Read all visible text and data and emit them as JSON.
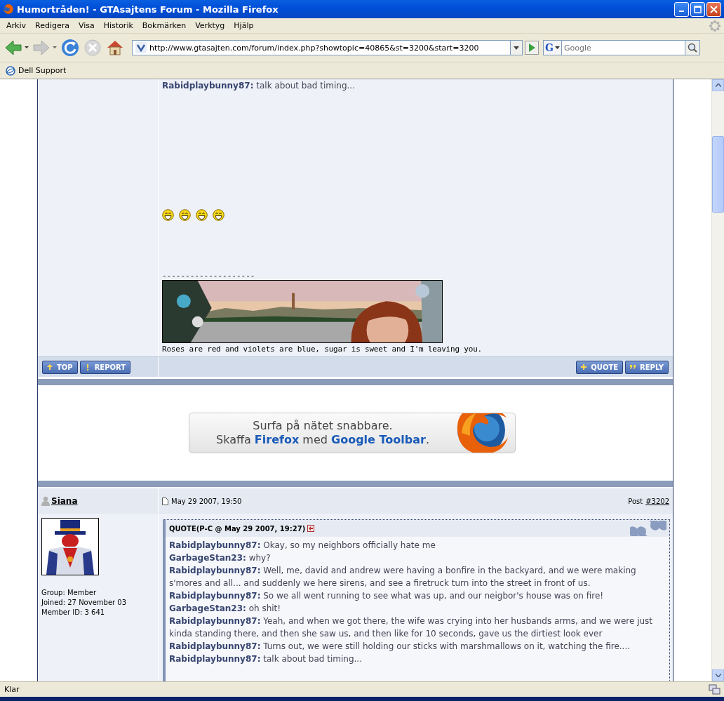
{
  "window": {
    "title": "Humortråden! - GTAsajtens Forum - Mozilla Firefox"
  },
  "menu": [
    "Arkiv",
    "Redigera",
    "Visa",
    "Historik",
    "Bokmärken",
    "Verktyg",
    "Hjälp"
  ],
  "toolbar": {
    "url": "http://www.gtasajten.com/forum/index.php?showtopic=40865&st=3200&start=3200",
    "search_engine": "G",
    "search_placeholder": "Google"
  },
  "bookmarks": [
    "Dell Support"
  ],
  "post_1": {
    "lines": [
      "**Rabidplaybunny87:** talk about bad timing..."
    ],
    "signature_rule": "--------------------",
    "signature": "Roses are red and violets are blue, sugar is sweet and I'm leaving you.",
    "buttons_left": [
      {
        "kind": "up",
        "label": "TOP"
      },
      {
        "kind": "alert",
        "label": "REPORT"
      }
    ],
    "buttons_right": [
      {
        "kind": "plus",
        "label": "QUOTE"
      },
      {
        "kind": "quote",
        "label": "REPLY"
      }
    ]
  },
  "ad": {
    "line_1": "Surfa på nätet snabbare.",
    "line_2": "Skaffa **Firefox** med **Google Toolbar**."
  },
  "post_2": {
    "author": "Siana",
    "date": "May 29 2007, 19:50",
    "post_label": "Post",
    "post_number": "#3202",
    "member_info": [
      "Group: Member",
      "Joined: 27 November 03",
      "Member ID: 3 641"
    ],
    "quote_header": "QUOTE(P-C @ May 29 2007, 19:27)",
    "quote_lines": [
      "**Rabidplaybunny87:** Okay, so my neighbors officially hate me",
      "**GarbageStan23:** why?",
      "**Rabidplaybunny87:** Well, me, david and andrew were having a bonfire in the backyard, and we were making s'mores and all... and suddenly we here sirens, and see a firetruck turn into the street in front of us.",
      "**Rabidplaybunny87:** So we all went running to see what was up, and our neigbor's house was on fire!",
      "**GarbageStan23:** oh shit!",
      "**Rabidplaybunny87:** Yeah, and when we got there, the wife was crying into her husbands arms, and we were just kinda standing there, and then she saw us, and then like for 10 seconds, gave us the dirtiest look ever",
      "**Rabidplaybunny87:** Turns out, we were still holding our sticks with marshmallows on it, watching the fire....",
      "**Rabidplaybunny87:** talk about bad timing..."
    ]
  },
  "status_bar": {
    "text": "Klar"
  }
}
